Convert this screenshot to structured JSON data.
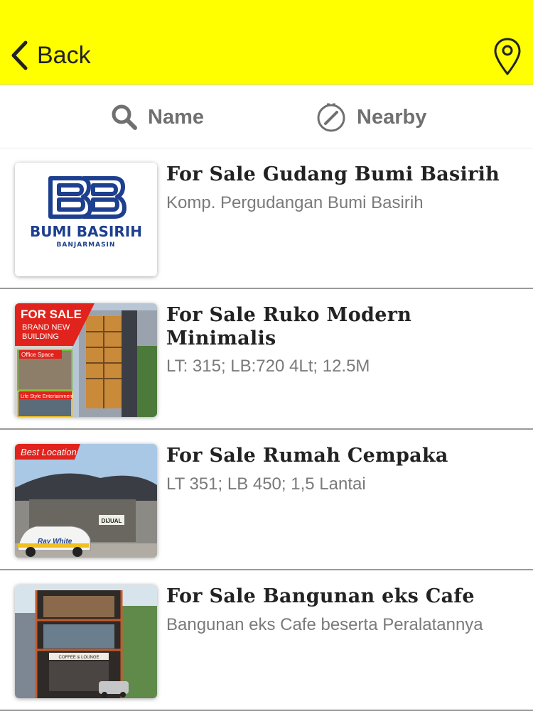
{
  "header": {
    "back_label": "Back",
    "background": "#ffff00",
    "location_icon": "map-pin-icon"
  },
  "tabs": [
    {
      "label": "Name",
      "icon": "search-icon"
    },
    {
      "label": "Nearby",
      "icon": "compass-icon"
    }
  ],
  "listings": [
    {
      "title": "For Sale Gudang Bumi Basirih",
      "subtitle": "Komp. Pergudangan Bumi Basirih",
      "thumb": {
        "logo_title": "BUMI BASIRIH",
        "logo_subtitle": "BANJARMASIN"
      }
    },
    {
      "title": "For Sale Ruko Modern Minimalis",
      "subtitle": "LT: 315; LB:720 4Lt; 12.5M",
      "thumb": {
        "banner": "FOR SALE",
        "banner_sub_1": "BRAND NEW",
        "banner_sub_2": "BUILDING",
        "tag_1": "Office Space",
        "tag_2": "Life Style Entertainment"
      }
    },
    {
      "title": "For Sale Rumah Cempaka",
      "subtitle": "LT 351; LB 450; 1,5 Lantai",
      "thumb": {
        "banner": "Best Location",
        "car_text": "Ray White",
        "sign_text": "DIJUAL"
      }
    },
    {
      "title": "For Sale Bangunan eks Cafe",
      "subtitle": "Bangunan eks Cafe beserta Peralatannya",
      "thumb": {
        "sign_text": "COFFEE & LOUNGE"
      }
    }
  ]
}
